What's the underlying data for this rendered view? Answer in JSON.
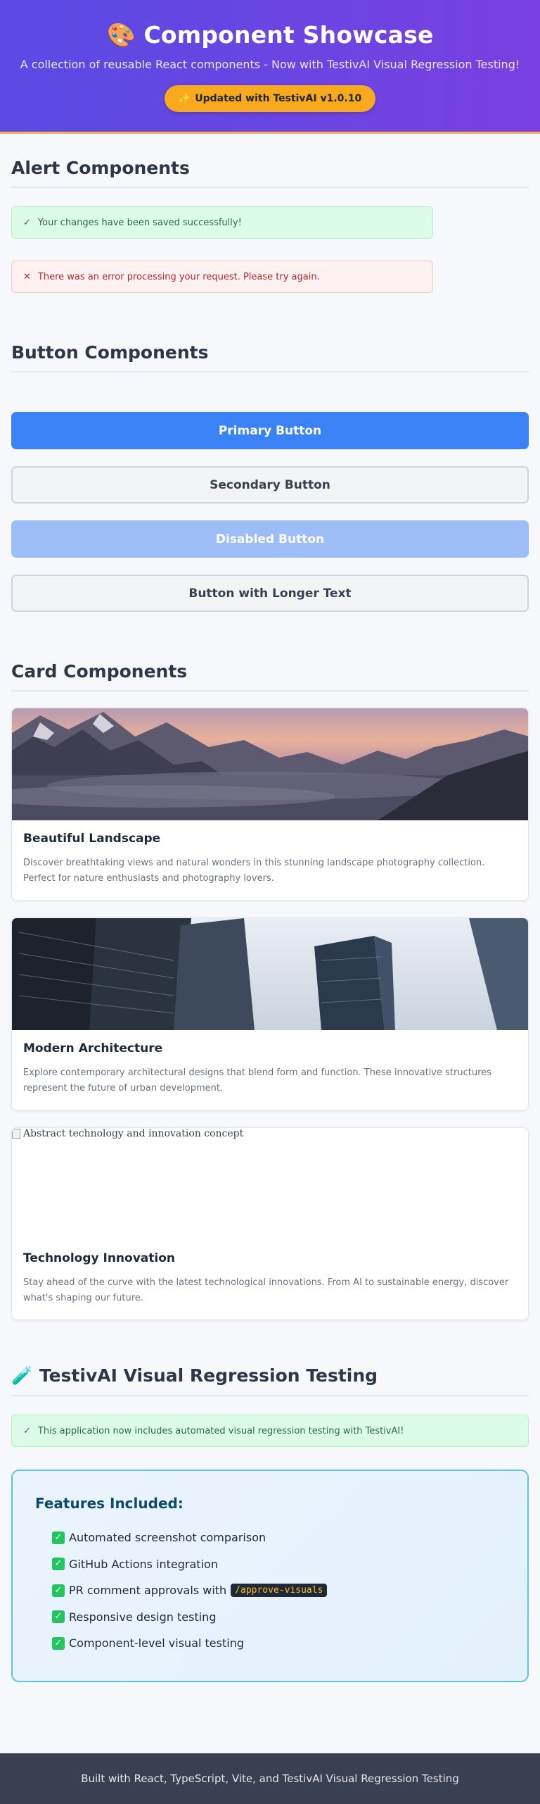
{
  "header": {
    "icon": "palette-icon",
    "icon_glyph": "🎨",
    "title": "Component Showcase",
    "subtitle": "A collection of reusable React components - Now with TestivAI Visual Regression Testing!",
    "badge_icon": "✨",
    "badge_label": "Updated with TestivAI v1.0.10"
  },
  "alerts": {
    "title": "Alert Components",
    "success": {
      "icon": "✓",
      "text": "Your changes have been saved successfully!"
    },
    "error": {
      "icon": "✕",
      "text": "There was an error processing your request. Please try again."
    }
  },
  "buttons": {
    "title": "Button Components",
    "primary": "Primary Button",
    "secondary": "Secondary Button",
    "disabled": "Disabled Button",
    "longer": "Button with Longer Text"
  },
  "cards": {
    "title": "Card Components",
    "items": [
      {
        "title": "Beautiful Landscape",
        "text": "Discover breathtaking views and natural wonders in this stunning landscape photography collection. Perfect for nature enthusiasts and photography lovers."
      },
      {
        "title": "Modern Architecture",
        "text": "Explore contemporary architectural designs that blend form and function. These innovative structures represent the future of urban development."
      },
      {
        "image_alt": "Abstract technology and innovation concept",
        "title": "Technology Innovation",
        "text": "Stay ahead of the curve with the latest technological innovations. From AI to sustainable energy, discover what's shaping our future."
      }
    ]
  },
  "testivai": {
    "icon": "test-tube-icon",
    "icon_glyph": "🧪",
    "title": "TestivAI Visual Regression Testing",
    "alert": {
      "icon": "✓",
      "text": "This application now includes automated visual regression testing with TestivAI!"
    },
    "features_title": "Features Included:",
    "check_glyph": "✓",
    "features": [
      "Automated screenshot comparison",
      "GitHub Actions integration",
      "PR comment approvals with",
      "Responsive design testing",
      "Component-level visual testing"
    ],
    "code_snippet": "/approve-visuals"
  },
  "footer": {
    "text": "Built with React, TypeScript, Vite, and TestivAI Visual Regression Testing"
  },
  "colors": {
    "header_gradient_start": "#5a4ae3",
    "header_gradient_end": "#7a3fe0",
    "badge": "#f8a91d",
    "primary": "#3b82f6",
    "success_bg": "#dcfce7",
    "error_bg": "#fef1f1",
    "features_border": "#5fc3e4",
    "footer_bg": "#374151"
  }
}
